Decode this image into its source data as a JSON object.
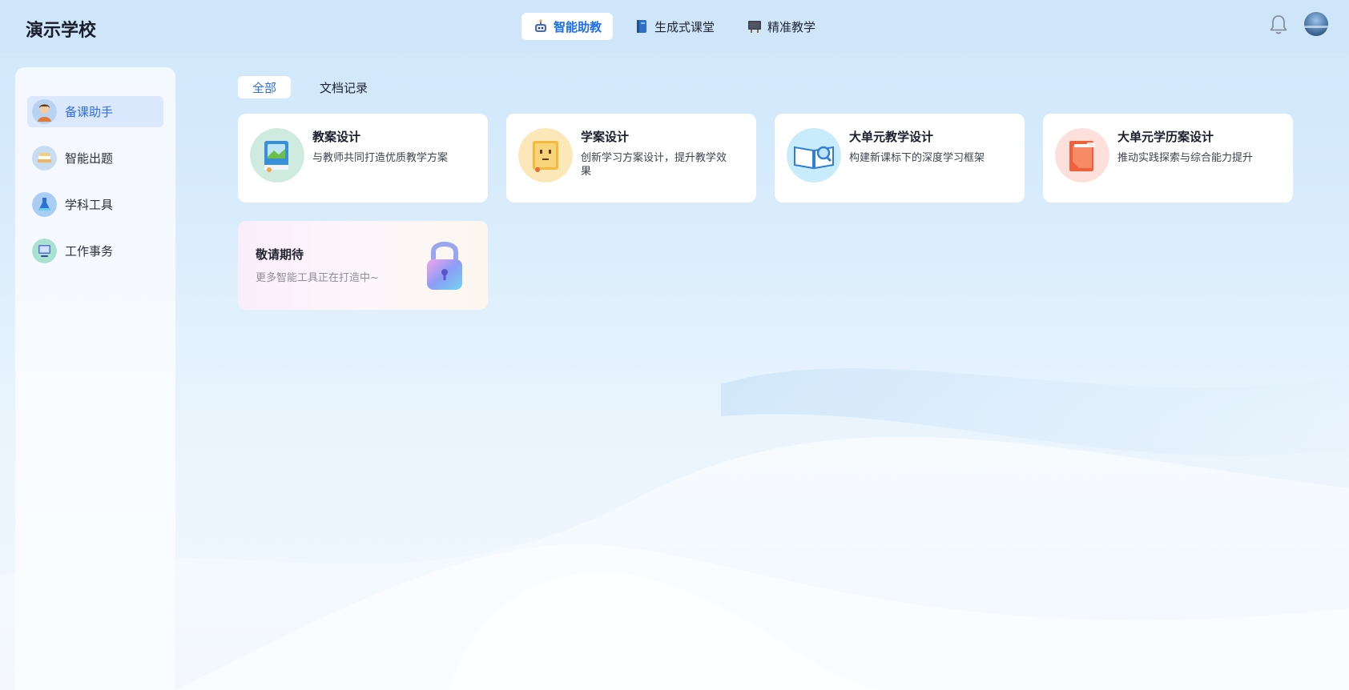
{
  "header": {
    "brand": "演示学校",
    "nav": [
      {
        "label": "智能助教",
        "icon": "robot-icon",
        "active": true
      },
      {
        "label": "生成式课堂",
        "icon": "book-icon",
        "active": false
      },
      {
        "label": "精准教学",
        "icon": "blackboard-icon",
        "active": false
      }
    ]
  },
  "sidebar": {
    "items": [
      {
        "label": "备课助手",
        "icon": "teacher-avatar-icon",
        "active": true
      },
      {
        "label": "智能出题",
        "icon": "books-icon",
        "active": false
      },
      {
        "label": "学科工具",
        "icon": "flask-icon",
        "active": false
      },
      {
        "label": "工作事务",
        "icon": "monitor-icon",
        "active": false
      }
    ]
  },
  "tabs": [
    {
      "label": "全部",
      "active": true
    },
    {
      "label": "文档记录",
      "active": false
    }
  ],
  "cards": [
    {
      "title": "教案设计",
      "desc": "与教师共同打造优质教学方案",
      "icon": "lesson-book-icon"
    },
    {
      "title": "学案设计",
      "desc": "创新学习方案设计，提升教学效果",
      "icon": "study-book-icon"
    },
    {
      "title": "大单元教学设计",
      "desc": "构建新课标下的深度学习框架",
      "icon": "open-book-search-icon"
    },
    {
      "title": "大单元学历案设计",
      "desc": "推动实践探索与综合能力提升",
      "icon": "document-folder-icon"
    }
  ],
  "coming_soon": {
    "title": "敬请期待",
    "subtitle": "更多智能工具正在打造中~",
    "icon": "lock-icon"
  },
  "colors": {
    "accent": "#2f6ee8",
    "active_bg": "#dbe8fd"
  }
}
